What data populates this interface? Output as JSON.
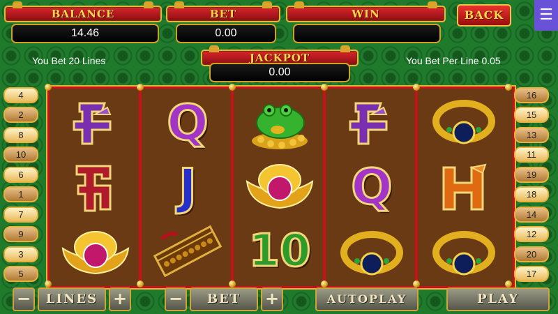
{
  "header": {
    "balance_label": "BALANCE",
    "balance_value": "14.46",
    "bet_label": "BET",
    "bet_value": "0.00",
    "win_label": "WIN",
    "win_value": "",
    "back_label": "BACK",
    "menu_icon": "menu-icon"
  },
  "jackpot": {
    "label": "JACKPOT",
    "value": "0.00"
  },
  "info": {
    "lines_text": "You Bet 20 Lines",
    "per_line_text": "You Bet Per Line 0.05"
  },
  "reels": [
    [
      "chinese-char-purple",
      "letter-q-purple",
      "letter-ka-red"
    ],
    [
      "letter-q-purple",
      "letter-j-blue",
      "abacus"
    ],
    [
      "golden-toad",
      "gold-ingot",
      "number-10-green"
    ],
    [
      "chinese-char-purple",
      "letter-q-purple",
      "jade-ring"
    ],
    [
      "jade-ring",
      "letter-k-orange",
      "jade-ring"
    ]
  ],
  "left_lines": [
    "4",
    "2",
    "8",
    "10",
    "6",
    "1",
    "7",
    "9",
    "3",
    "5"
  ],
  "right_lines": [
    "16",
    "15",
    "13",
    "11",
    "19",
    "18",
    "14",
    "12",
    "20",
    "17"
  ],
  "controls": {
    "lines_label": "LINES",
    "bet_label": "BET",
    "autoplay_label": "AUTOPLAY",
    "play_label": "PLAY",
    "minus": "−",
    "plus": "+"
  },
  "colors": {
    "background": "#1f7a2b",
    "plate_red": "#c8121a",
    "gold": "#e6b43c",
    "reel_bg": "#6a3a14"
  }
}
